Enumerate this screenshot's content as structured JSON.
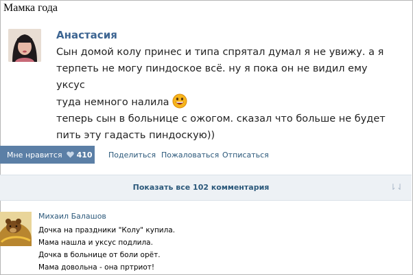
{
  "page_title": "Мамка года",
  "post": {
    "author": "Анастасия",
    "lines": [
      "Сын домой колу принес и типа спрятал думал я не увижу. а я",
      "терпеть не могу пиндоское всё. ну я пока он не видил ему уксус",
      "туда немного налила"
    ],
    "lines2": [
      "теперь сын в больнице с ожогом. сказал что больше не будет",
      "пить эту гадасть пиндоскую))"
    ],
    "emoji": "grinning-face-icon"
  },
  "actions": {
    "like_label": "Мне нравится",
    "like_count": "410",
    "share": "Поделиться",
    "report": "Пожаловаться",
    "unsubscribe": "Отписаться"
  },
  "comments_bar": {
    "label": "Показать все 102 комментария",
    "sort_icon": "⇂⇃"
  },
  "comment": {
    "author": "Михаил Балашов",
    "lines": [
      "Дочка на праздники \"Колу\" купила.",
      "Мама нашла и уксус подлила.",
      "Дочка в больнице от боли орёт.",
      "Мама довольна - она пртриот!"
    ]
  },
  "colors": {
    "link": "#2b587a",
    "author": "#3d6592",
    "like_button": "#5b7fa6",
    "comments_bar": "#edf1f5"
  }
}
